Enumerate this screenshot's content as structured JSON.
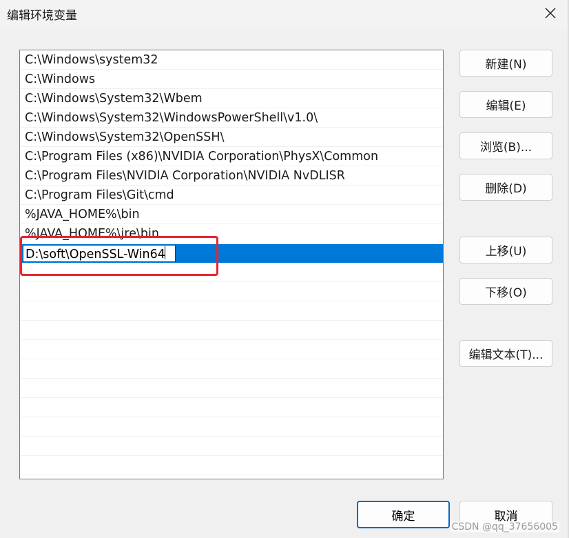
{
  "window": {
    "title": "编辑环境变量"
  },
  "path_list": {
    "items": [
      "C:\\Windows\\system32",
      "C:\\Windows",
      "C:\\Windows\\System32\\Wbem",
      "C:\\Windows\\System32\\WindowsPowerShell\\v1.0\\",
      "C:\\Windows\\System32\\OpenSSH\\",
      "C:\\Program Files (x86)\\NVIDIA Corporation\\PhysX\\Common",
      "C:\\Program Files\\NVIDIA Corporation\\NVIDIA NvDLISR",
      "C:\\Program Files\\Git\\cmd",
      "%JAVA_HOME%\\bin",
      "%JAVA_HOME%\\jre\\bin"
    ],
    "editing_value": "D:\\soft\\OpenSSL-Win64"
  },
  "buttons": {
    "new": "新建(N)",
    "edit": "编辑(E)",
    "browse": "浏览(B)...",
    "delete": "删除(D)",
    "move_up": "上移(U)",
    "move_down": "下移(O)",
    "edit_text": "编辑文本(T)...",
    "ok": "确定",
    "cancel": "取消"
  },
  "watermark": "CSDN @qq_37656005",
  "colors": {
    "selection": "#0078d7",
    "highlight_box": "#e8242e",
    "ok_border": "#0067c0"
  }
}
